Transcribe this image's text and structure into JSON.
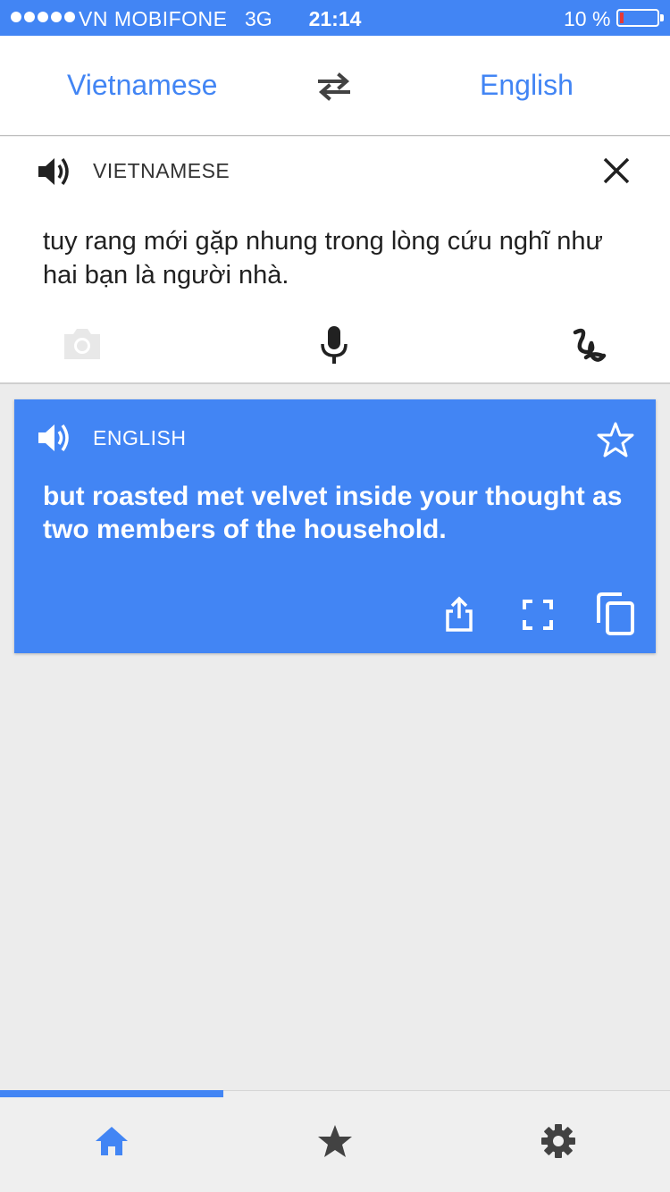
{
  "status_bar": {
    "carrier": "VN MOBIFONE",
    "network": "3G",
    "time": "21:14",
    "battery": "10 %",
    "battery_level": 0.1
  },
  "language_bar": {
    "source_language": "Vietnamese",
    "target_language": "English",
    "swap_icon": "swap-arrows-icon"
  },
  "input": {
    "language_label": "VIETNAMESE",
    "text": "tuy rang mới gặp nhung trong lòng cứu nghĩ như hai bạn là người nhà.",
    "icons": [
      "speaker-icon",
      "close-icon",
      "camera-icon",
      "microphone-icon",
      "handwriting-icon"
    ]
  },
  "result": {
    "language_label": "ENGLISH",
    "text": "but roasted met velvet inside your thought as two members of the household.",
    "icons": [
      "speaker-icon",
      "star-icon",
      "share-icon",
      "fullscreen-icon",
      "copy-icon"
    ]
  },
  "tabs": {
    "items": [
      "home-icon",
      "star-icon",
      "gear-icon"
    ],
    "active": "home"
  },
  "colors": {
    "accent": "#4285f4",
    "background": "#ececec",
    "battery_low": "#e53935"
  }
}
